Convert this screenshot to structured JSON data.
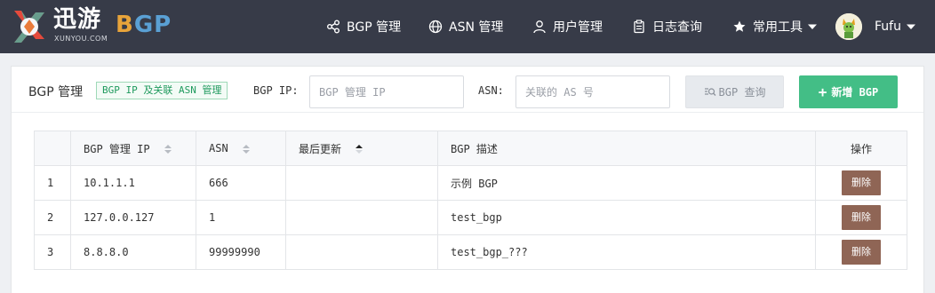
{
  "brand": {
    "name_cn": "迅游",
    "url": "XUNYOU.COM",
    "product_b": "B",
    "product_gp": "GP"
  },
  "nav": {
    "items": [
      {
        "label": "BGP 管理",
        "icon": "share-nodes-icon"
      },
      {
        "label": "ASN 管理",
        "icon": "globe-icon"
      },
      {
        "label": "用户管理",
        "icon": "user-icon"
      },
      {
        "label": "日志查询",
        "icon": "clipboard-icon"
      },
      {
        "label": "常用工具",
        "icon": "star-icon"
      }
    ],
    "username": "Fufu"
  },
  "panel": {
    "title": "BGP 管理",
    "badge": "BGP IP 及关联 ASN 管理",
    "bgp_ip_label": "BGP IP:",
    "bgp_ip_placeholder": "BGP 管理 IP",
    "asn_label": "ASN:",
    "asn_placeholder": "关联的 AS 号",
    "query_button": "BGP 查询",
    "add_button": "新增 BGP"
  },
  "table": {
    "columns": [
      "",
      "BGP 管理 IP",
      "ASN",
      "最后更新",
      "BGP 描述",
      "操作"
    ],
    "rows": [
      {
        "index": "1",
        "ip": "10.1.1.1",
        "asn": "666",
        "updated": "",
        "desc": "示例 BGP",
        "action": "删除"
      },
      {
        "index": "2",
        "ip": "127.0.0.127",
        "asn": "1",
        "updated": "",
        "desc": "test_bgp",
        "action": "删除"
      },
      {
        "index": "3",
        "ip": "8.8.8.0",
        "asn": "99999990",
        "updated": "",
        "desc": "test_bgp_???",
        "action": "删除"
      }
    ]
  },
  "colors": {
    "navbar": "#373b48",
    "add_button": "#43be86",
    "delete_button": "#8f6555",
    "badge_text": "#1f9a5d"
  }
}
